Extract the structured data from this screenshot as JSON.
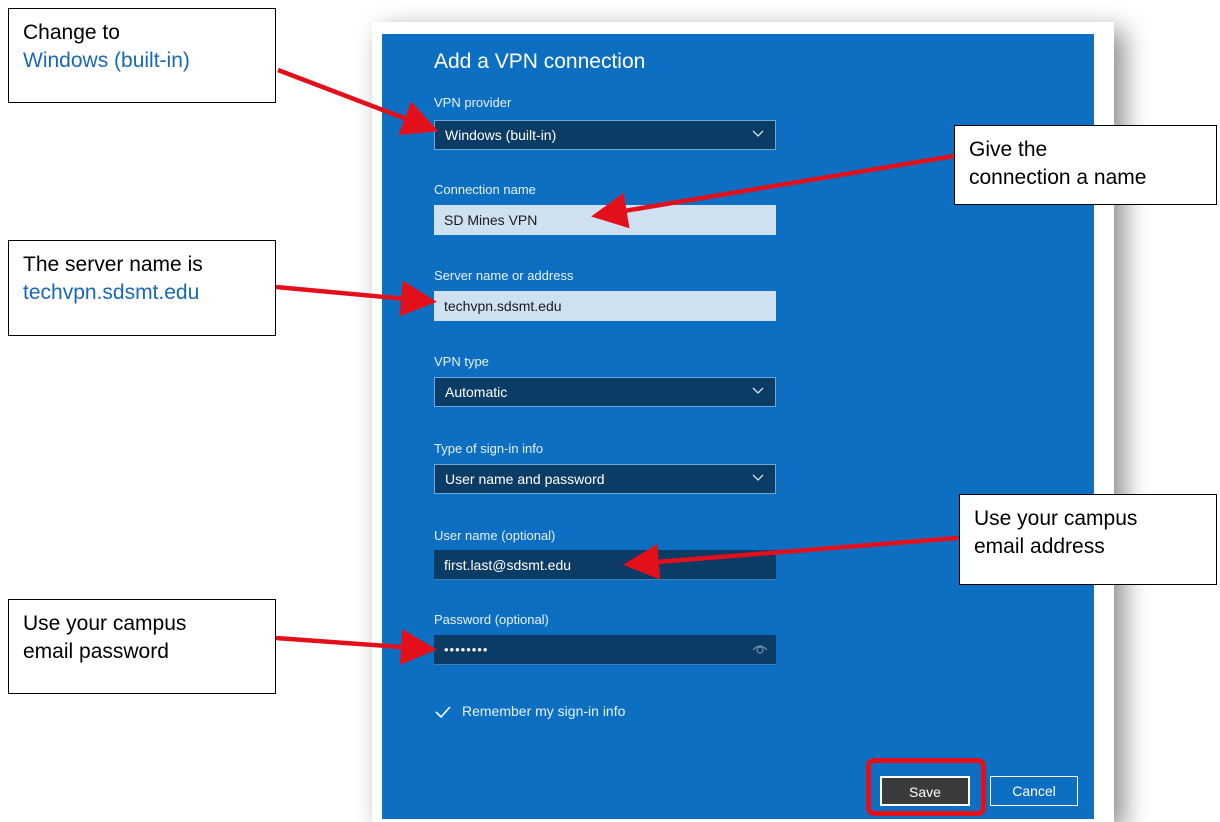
{
  "dialog": {
    "title": "Add a VPN connection",
    "vpn_provider": {
      "label": "VPN provider",
      "value": "Windows (built-in)"
    },
    "connection_name": {
      "label": "Connection name",
      "value": "SD Mines VPN"
    },
    "server": {
      "label": "Server name or address",
      "value": "techvpn.sdsmt.edu"
    },
    "vpn_type": {
      "label": "VPN type",
      "value": "Automatic"
    },
    "signin_type": {
      "label": "Type of sign-in info",
      "value": "User name and password"
    },
    "username": {
      "label": "User name (optional)",
      "value": "first.last@sdsmt.edu"
    },
    "password": {
      "label": "Password (optional)",
      "value": "••••••••"
    },
    "remember": {
      "label": "Remember my sign-in info",
      "checked": true
    },
    "save_label": "Save",
    "cancel_label": "Cancel"
  },
  "callouts": {
    "provider": {
      "line1": "Change to",
      "line2": "Windows (built-in)"
    },
    "name": {
      "line1": "Give the",
      "line2": "connection a name"
    },
    "server": {
      "line1": "The server name is",
      "line2": "techvpn.sdsmt.edu"
    },
    "email": {
      "line1": "Use your campus",
      "line2": "email address"
    },
    "password": {
      "line1": "Use your campus",
      "line2": "email password"
    }
  },
  "colors": {
    "dialog_bg": "#0c6fc2",
    "field_dark": "#0b3c66",
    "field_light": "#cfe1f1",
    "arrow_red": "#e3101b",
    "callout_highlight": "#1868b8"
  },
  "icons": [
    "chevron-down-icon",
    "eye-icon",
    "checkmark-icon"
  ]
}
